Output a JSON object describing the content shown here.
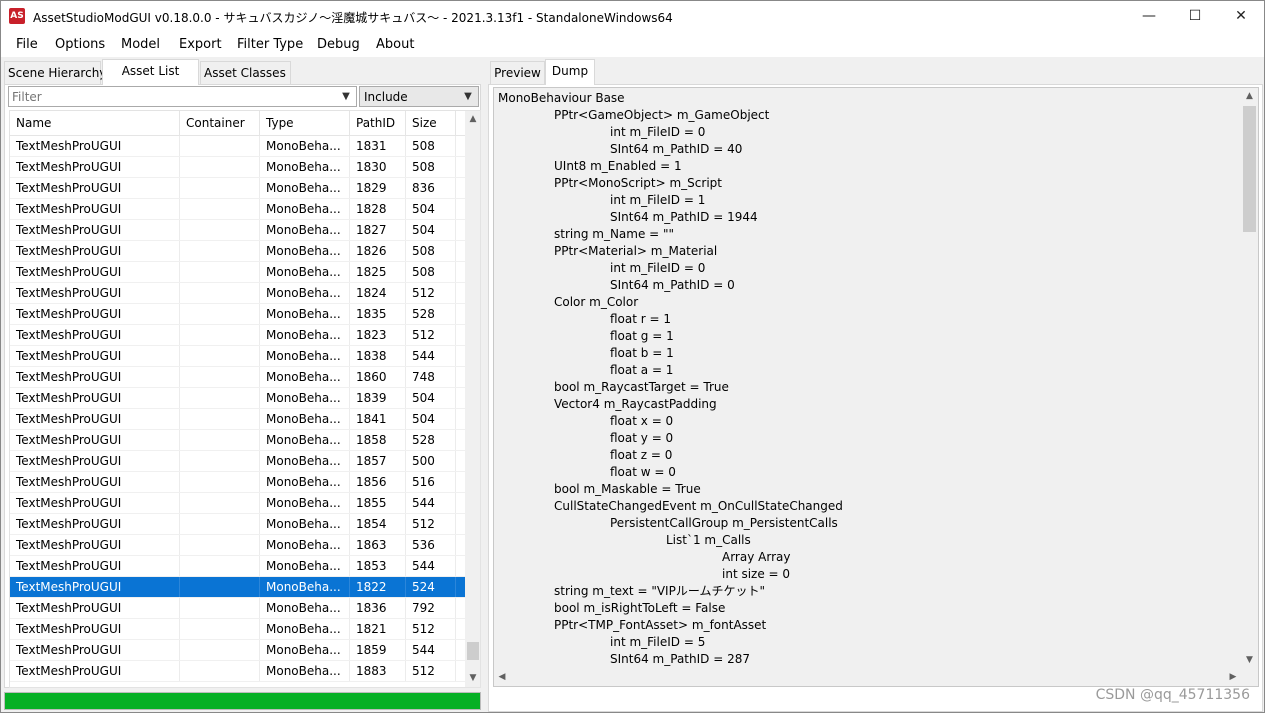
{
  "window": {
    "title": "AssetStudioModGUI v0.18.0.0 - サキュバスカジノ～淫魔城サキュバス～ - 2021.3.13f1 - StandaloneWindows64",
    "icon_label": "AS",
    "controls": {
      "minimize": "—",
      "maximize": "☐",
      "close": "✕"
    }
  },
  "menu": [
    "File",
    "Options",
    "Model",
    "Export",
    "Filter Type",
    "Debug",
    "About"
  ],
  "left_tabs": [
    "Scene Hierarchy",
    "Asset List",
    "Asset Classes"
  ],
  "left_active_tab": "Asset List",
  "filter": {
    "placeholder": "Filter",
    "value": ""
  },
  "include_select": {
    "value": "Include"
  },
  "asset_list": {
    "columns": [
      "Name",
      "Container",
      "Type",
      "PathID",
      "Size"
    ],
    "rows": [
      {
        "name": "TextMeshProUGUI",
        "container": "",
        "type": "MonoBeha...",
        "pathid": "1831",
        "size": "508"
      },
      {
        "name": "TextMeshProUGUI",
        "container": "",
        "type": "MonoBeha...",
        "pathid": "1830",
        "size": "508"
      },
      {
        "name": "TextMeshProUGUI",
        "container": "",
        "type": "MonoBeha...",
        "pathid": "1829",
        "size": "836"
      },
      {
        "name": "TextMeshProUGUI",
        "container": "",
        "type": "MonoBeha...",
        "pathid": "1828",
        "size": "504"
      },
      {
        "name": "TextMeshProUGUI",
        "container": "",
        "type": "MonoBeha...",
        "pathid": "1827",
        "size": "504"
      },
      {
        "name": "TextMeshProUGUI",
        "container": "",
        "type": "MonoBeha...",
        "pathid": "1826",
        "size": "508"
      },
      {
        "name": "TextMeshProUGUI",
        "container": "",
        "type": "MonoBeha...",
        "pathid": "1825",
        "size": "508"
      },
      {
        "name": "TextMeshProUGUI",
        "container": "",
        "type": "MonoBeha...",
        "pathid": "1824",
        "size": "512"
      },
      {
        "name": "TextMeshProUGUI",
        "container": "",
        "type": "MonoBeha...",
        "pathid": "1835",
        "size": "528"
      },
      {
        "name": "TextMeshProUGUI",
        "container": "",
        "type": "MonoBeha...",
        "pathid": "1823",
        "size": "512"
      },
      {
        "name": "TextMeshProUGUI",
        "container": "",
        "type": "MonoBeha...",
        "pathid": "1838",
        "size": "544"
      },
      {
        "name": "TextMeshProUGUI",
        "container": "",
        "type": "MonoBeha...",
        "pathid": "1860",
        "size": "748"
      },
      {
        "name": "TextMeshProUGUI",
        "container": "",
        "type": "MonoBeha...",
        "pathid": "1839",
        "size": "504"
      },
      {
        "name": "TextMeshProUGUI",
        "container": "",
        "type": "MonoBeha...",
        "pathid": "1841",
        "size": "504"
      },
      {
        "name": "TextMeshProUGUI",
        "container": "",
        "type": "MonoBeha...",
        "pathid": "1858",
        "size": "528"
      },
      {
        "name": "TextMeshProUGUI",
        "container": "",
        "type": "MonoBeha...",
        "pathid": "1857",
        "size": "500"
      },
      {
        "name": "TextMeshProUGUI",
        "container": "",
        "type": "MonoBeha...",
        "pathid": "1856",
        "size": "516"
      },
      {
        "name": "TextMeshProUGUI",
        "container": "",
        "type": "MonoBeha...",
        "pathid": "1855",
        "size": "544"
      },
      {
        "name": "TextMeshProUGUI",
        "container": "",
        "type": "MonoBeha...",
        "pathid": "1854",
        "size": "512"
      },
      {
        "name": "TextMeshProUGUI",
        "container": "",
        "type": "MonoBeha...",
        "pathid": "1863",
        "size": "536"
      },
      {
        "name": "TextMeshProUGUI",
        "container": "",
        "type": "MonoBeha...",
        "pathid": "1853",
        "size": "544"
      },
      {
        "name": "TextMeshProUGUI",
        "container": "",
        "type": "MonoBeha...",
        "pathid": "1822",
        "size": "524",
        "selected": true
      },
      {
        "name": "TextMeshProUGUI",
        "container": "",
        "type": "MonoBeha...",
        "pathid": "1836",
        "size": "792"
      },
      {
        "name": "TextMeshProUGUI",
        "container": "",
        "type": "MonoBeha...",
        "pathid": "1821",
        "size": "512"
      },
      {
        "name": "TextMeshProUGUI",
        "container": "",
        "type": "MonoBeha...",
        "pathid": "1859",
        "size": "544"
      },
      {
        "name": "TextMeshProUGUI",
        "container": "",
        "type": "MonoBeha...",
        "pathid": "1883",
        "size": "512"
      }
    ]
  },
  "progress": {
    "fraction": 1.0,
    "color": "#06b025"
  },
  "right_tabs": [
    "Preview",
    "Dump"
  ],
  "right_active_tab": "Dump",
  "dump_lines": [
    {
      "indent": 0,
      "text": "MonoBehaviour Base"
    },
    {
      "indent": 1,
      "text": "PPtr<GameObject> m_GameObject"
    },
    {
      "indent": 2,
      "text": "int m_FileID = 0"
    },
    {
      "indent": 2,
      "text": "SInt64 m_PathID = 40"
    },
    {
      "indent": 1,
      "text": "UInt8 m_Enabled = 1"
    },
    {
      "indent": 1,
      "text": "PPtr<MonoScript> m_Script"
    },
    {
      "indent": 2,
      "text": "int m_FileID = 1"
    },
    {
      "indent": 2,
      "text": "SInt64 m_PathID = 1944"
    },
    {
      "indent": 1,
      "text": "string m_Name = \"\""
    },
    {
      "indent": 1,
      "text": "PPtr<Material> m_Material"
    },
    {
      "indent": 2,
      "text": "int m_FileID = 0"
    },
    {
      "indent": 2,
      "text": "SInt64 m_PathID = 0"
    },
    {
      "indent": 1,
      "text": "Color m_Color"
    },
    {
      "indent": 2,
      "text": "float r = 1"
    },
    {
      "indent": 2,
      "text": "float g = 1"
    },
    {
      "indent": 2,
      "text": "float b = 1"
    },
    {
      "indent": 2,
      "text": "float a = 1"
    },
    {
      "indent": 1,
      "text": "bool m_RaycastTarget = True"
    },
    {
      "indent": 1,
      "text": "Vector4 m_RaycastPadding"
    },
    {
      "indent": 2,
      "text": "float x = 0"
    },
    {
      "indent": 2,
      "text": "float y = 0"
    },
    {
      "indent": 2,
      "text": "float z = 0"
    },
    {
      "indent": 2,
      "text": "float w = 0"
    },
    {
      "indent": 1,
      "text": "bool m_Maskable = True"
    },
    {
      "indent": 1,
      "text": "CullStateChangedEvent m_OnCullStateChanged"
    },
    {
      "indent": 2,
      "text": "PersistentCallGroup m_PersistentCalls"
    },
    {
      "indent": 3,
      "text": "List`1 m_Calls"
    },
    {
      "indent": 4,
      "text": "Array Array"
    },
    {
      "indent": 4,
      "text": "int size = 0"
    },
    {
      "indent": 1,
      "text": "string m_text = \"VIPルームチケット\""
    },
    {
      "indent": 1,
      "text": "bool m_isRightToLeft = False"
    },
    {
      "indent": 1,
      "text": "PPtr<TMP_FontAsset> m_fontAsset"
    },
    {
      "indent": 2,
      "text": "int m_FileID = 5"
    },
    {
      "indent": 2,
      "text": "SInt64 m_PathID = 287"
    }
  ],
  "watermark": "CSDN @qq_45711356",
  "colors": {
    "selection": "#0a74d4",
    "progress": "#06b025",
    "app_icon": "#c8202a"
  }
}
